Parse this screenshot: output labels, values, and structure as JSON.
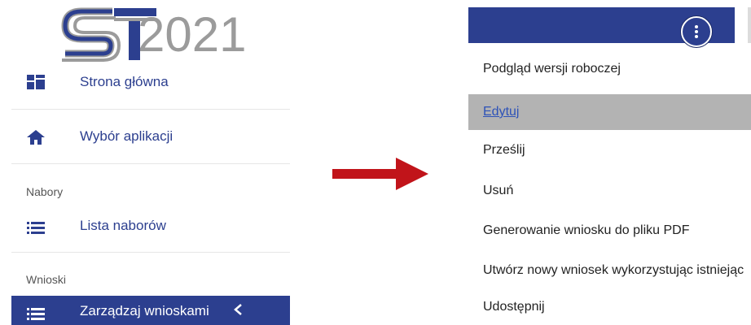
{
  "logo": {
    "letters": "ST",
    "year": "2021"
  },
  "sidebar": {
    "items": [
      {
        "label": "Strona główna",
        "icon": "dashboard-icon"
      },
      {
        "label": "Wybór aplikacji",
        "icon": "home-icon"
      },
      {
        "label": "Lista naborów",
        "icon": "list-icon"
      },
      {
        "label": "Zarządzaj wnioskami",
        "icon": "list-icon",
        "active": true
      }
    ],
    "sections": {
      "nabory": "Nabory",
      "wnioski": "Wnioski"
    }
  },
  "menu": {
    "items": [
      "Podgląd wersji roboczej",
      "Edytuj",
      "Prześlij",
      "Usuń",
      "Generowanie wniosku do pliku PDF",
      "Utwórz nowy wniosek wykorzystując istniejąc",
      "Udostępnij"
    ],
    "active_index": 1
  },
  "colors": {
    "primary": "#2c3f8f",
    "arrow": "#c1141a",
    "highlight": "#b3b3b3",
    "link": "#2d52b8",
    "logo_gray": "#9b9b9b"
  }
}
